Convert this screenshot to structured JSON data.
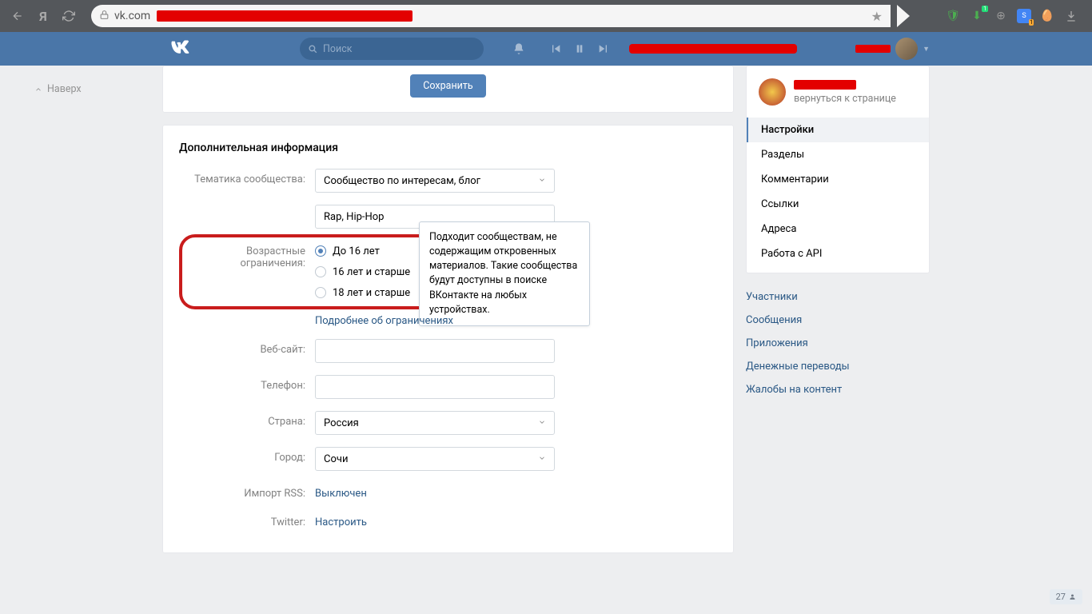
{
  "browser": {
    "url_domain": "vk.com"
  },
  "header": {
    "search_placeholder": "Поиск"
  },
  "left": {
    "top": "Наверх"
  },
  "save": {
    "btn": "Сохранить"
  },
  "card": {
    "title": "Дополнительная информация",
    "labels": {
      "topic": "Тематика сообщества:",
      "age": "Возрастные ограничения:",
      "website": "Веб-сайт:",
      "phone": "Телефон:",
      "country": "Страна:",
      "city": "Город:",
      "rss": "Импорт RSS:",
      "twitter": "Twitter:"
    },
    "topic_value": "Сообщество по интересам, блог",
    "genre_value": "Rap, Hip-Hop",
    "age_opts": [
      "До 16 лет",
      "16 лет и старше",
      "18 лет и старше"
    ],
    "more_link": "Подробнее об ограничениях",
    "country_value": "Россия",
    "city_value": "Сочи",
    "rss_value": "Выключен",
    "twitter_value": "Настроить",
    "tooltip": "Подходит сообществам, не содержащим откровенных материалов. Такие сообщества будут доступны в поиске ВКонтакте на любых устройствах."
  },
  "side": {
    "back": "вернуться к странице",
    "menu": [
      "Настройки",
      "Разделы",
      "Комментарии",
      "Ссылки",
      "Адреса",
      "Работа с API"
    ],
    "links": [
      "Участники",
      "Сообщения",
      "Приложения",
      "Денежные переводы",
      "Жалобы на контент"
    ]
  },
  "counter": "27"
}
